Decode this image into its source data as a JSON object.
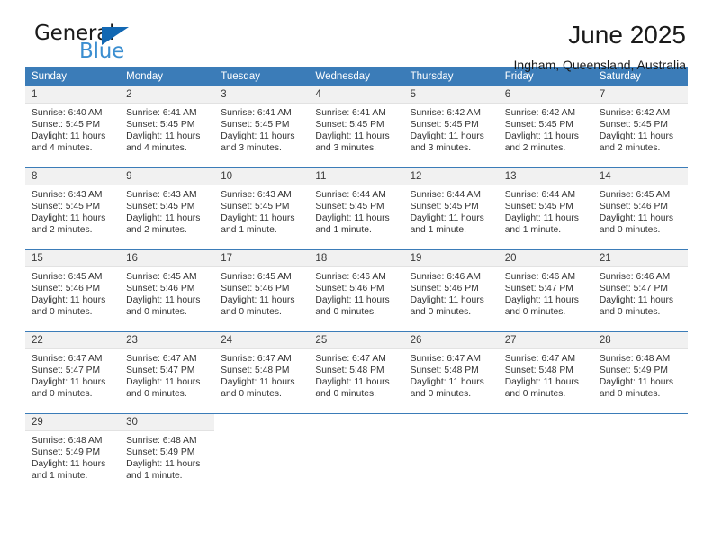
{
  "brand": {
    "name_primary": "General",
    "name_secondary": "Blue",
    "triangle_color": "#1268b3",
    "blue_color": "#3b8ed0"
  },
  "header": {
    "title": "June 2025",
    "location": "Ingham, Queensland, Australia"
  },
  "theme": {
    "header_row_bg": "#3b7cb8",
    "header_row_text": "#ffffff",
    "date_band_bg": "#f1f1f1",
    "cell_border": "#3b7cb8"
  },
  "weekdays": [
    "Sunday",
    "Monday",
    "Tuesday",
    "Wednesday",
    "Thursday",
    "Friday",
    "Saturday"
  ],
  "calendar": {
    "month": "June",
    "year": 2025,
    "weeks": [
      [
        {
          "day": "1",
          "sunrise": "Sunrise: 6:40 AM",
          "sunset": "Sunset: 5:45 PM",
          "daylight_line1": "Daylight: 11 hours",
          "daylight_line2": "and 4 minutes."
        },
        {
          "day": "2",
          "sunrise": "Sunrise: 6:41 AM",
          "sunset": "Sunset: 5:45 PM",
          "daylight_line1": "Daylight: 11 hours",
          "daylight_line2": "and 4 minutes."
        },
        {
          "day": "3",
          "sunrise": "Sunrise: 6:41 AM",
          "sunset": "Sunset: 5:45 PM",
          "daylight_line1": "Daylight: 11 hours",
          "daylight_line2": "and 3 minutes."
        },
        {
          "day": "4",
          "sunrise": "Sunrise: 6:41 AM",
          "sunset": "Sunset: 5:45 PM",
          "daylight_line1": "Daylight: 11 hours",
          "daylight_line2": "and 3 minutes."
        },
        {
          "day": "5",
          "sunrise": "Sunrise: 6:42 AM",
          "sunset": "Sunset: 5:45 PM",
          "daylight_line1": "Daylight: 11 hours",
          "daylight_line2": "and 3 minutes."
        },
        {
          "day": "6",
          "sunrise": "Sunrise: 6:42 AM",
          "sunset": "Sunset: 5:45 PM",
          "daylight_line1": "Daylight: 11 hours",
          "daylight_line2": "and 2 minutes."
        },
        {
          "day": "7",
          "sunrise": "Sunrise: 6:42 AM",
          "sunset": "Sunset: 5:45 PM",
          "daylight_line1": "Daylight: 11 hours",
          "daylight_line2": "and 2 minutes."
        }
      ],
      [
        {
          "day": "8",
          "sunrise": "Sunrise: 6:43 AM",
          "sunset": "Sunset: 5:45 PM",
          "daylight_line1": "Daylight: 11 hours",
          "daylight_line2": "and 2 minutes."
        },
        {
          "day": "9",
          "sunrise": "Sunrise: 6:43 AM",
          "sunset": "Sunset: 5:45 PM",
          "daylight_line1": "Daylight: 11 hours",
          "daylight_line2": "and 2 minutes."
        },
        {
          "day": "10",
          "sunrise": "Sunrise: 6:43 AM",
          "sunset": "Sunset: 5:45 PM",
          "daylight_line1": "Daylight: 11 hours",
          "daylight_line2": "and 1 minute."
        },
        {
          "day": "11",
          "sunrise": "Sunrise: 6:44 AM",
          "sunset": "Sunset: 5:45 PM",
          "daylight_line1": "Daylight: 11 hours",
          "daylight_line2": "and 1 minute."
        },
        {
          "day": "12",
          "sunrise": "Sunrise: 6:44 AM",
          "sunset": "Sunset: 5:45 PM",
          "daylight_line1": "Daylight: 11 hours",
          "daylight_line2": "and 1 minute."
        },
        {
          "day": "13",
          "sunrise": "Sunrise: 6:44 AM",
          "sunset": "Sunset: 5:45 PM",
          "daylight_line1": "Daylight: 11 hours",
          "daylight_line2": "and 1 minute."
        },
        {
          "day": "14",
          "sunrise": "Sunrise: 6:45 AM",
          "sunset": "Sunset: 5:46 PM",
          "daylight_line1": "Daylight: 11 hours",
          "daylight_line2": "and 0 minutes."
        }
      ],
      [
        {
          "day": "15",
          "sunrise": "Sunrise: 6:45 AM",
          "sunset": "Sunset: 5:46 PM",
          "daylight_line1": "Daylight: 11 hours",
          "daylight_line2": "and 0 minutes."
        },
        {
          "day": "16",
          "sunrise": "Sunrise: 6:45 AM",
          "sunset": "Sunset: 5:46 PM",
          "daylight_line1": "Daylight: 11 hours",
          "daylight_line2": "and 0 minutes."
        },
        {
          "day": "17",
          "sunrise": "Sunrise: 6:45 AM",
          "sunset": "Sunset: 5:46 PM",
          "daylight_line1": "Daylight: 11 hours",
          "daylight_line2": "and 0 minutes."
        },
        {
          "day": "18",
          "sunrise": "Sunrise: 6:46 AM",
          "sunset": "Sunset: 5:46 PM",
          "daylight_line1": "Daylight: 11 hours",
          "daylight_line2": "and 0 minutes."
        },
        {
          "day": "19",
          "sunrise": "Sunrise: 6:46 AM",
          "sunset": "Sunset: 5:46 PM",
          "daylight_line1": "Daylight: 11 hours",
          "daylight_line2": "and 0 minutes."
        },
        {
          "day": "20",
          "sunrise": "Sunrise: 6:46 AM",
          "sunset": "Sunset: 5:47 PM",
          "daylight_line1": "Daylight: 11 hours",
          "daylight_line2": "and 0 minutes."
        },
        {
          "day": "21",
          "sunrise": "Sunrise: 6:46 AM",
          "sunset": "Sunset: 5:47 PM",
          "daylight_line1": "Daylight: 11 hours",
          "daylight_line2": "and 0 minutes."
        }
      ],
      [
        {
          "day": "22",
          "sunrise": "Sunrise: 6:47 AM",
          "sunset": "Sunset: 5:47 PM",
          "daylight_line1": "Daylight: 11 hours",
          "daylight_line2": "and 0 minutes."
        },
        {
          "day": "23",
          "sunrise": "Sunrise: 6:47 AM",
          "sunset": "Sunset: 5:47 PM",
          "daylight_line1": "Daylight: 11 hours",
          "daylight_line2": "and 0 minutes."
        },
        {
          "day": "24",
          "sunrise": "Sunrise: 6:47 AM",
          "sunset": "Sunset: 5:48 PM",
          "daylight_line1": "Daylight: 11 hours",
          "daylight_line2": "and 0 minutes."
        },
        {
          "day": "25",
          "sunrise": "Sunrise: 6:47 AM",
          "sunset": "Sunset: 5:48 PM",
          "daylight_line1": "Daylight: 11 hours",
          "daylight_line2": "and 0 minutes."
        },
        {
          "day": "26",
          "sunrise": "Sunrise: 6:47 AM",
          "sunset": "Sunset: 5:48 PM",
          "daylight_line1": "Daylight: 11 hours",
          "daylight_line2": "and 0 minutes."
        },
        {
          "day": "27",
          "sunrise": "Sunrise: 6:47 AM",
          "sunset": "Sunset: 5:48 PM",
          "daylight_line1": "Daylight: 11 hours",
          "daylight_line2": "and 0 minutes."
        },
        {
          "day": "28",
          "sunrise": "Sunrise: 6:48 AM",
          "sunset": "Sunset: 5:49 PM",
          "daylight_line1": "Daylight: 11 hours",
          "daylight_line2": "and 0 minutes."
        }
      ],
      [
        {
          "day": "29",
          "sunrise": "Sunrise: 6:48 AM",
          "sunset": "Sunset: 5:49 PM",
          "daylight_line1": "Daylight: 11 hours",
          "daylight_line2": "and 1 minute."
        },
        {
          "day": "30",
          "sunrise": "Sunrise: 6:48 AM",
          "sunset": "Sunset: 5:49 PM",
          "daylight_line1": "Daylight: 11 hours",
          "daylight_line2": "and 1 minute."
        },
        {
          "day": "",
          "sunrise": "",
          "sunset": "",
          "daylight_line1": "",
          "daylight_line2": ""
        },
        {
          "day": "",
          "sunrise": "",
          "sunset": "",
          "daylight_line1": "",
          "daylight_line2": ""
        },
        {
          "day": "",
          "sunrise": "",
          "sunset": "",
          "daylight_line1": "",
          "daylight_line2": ""
        },
        {
          "day": "",
          "sunrise": "",
          "sunset": "",
          "daylight_line1": "",
          "daylight_line2": ""
        },
        {
          "day": "",
          "sunrise": "",
          "sunset": "",
          "daylight_line1": "",
          "daylight_line2": ""
        }
      ]
    ]
  }
}
